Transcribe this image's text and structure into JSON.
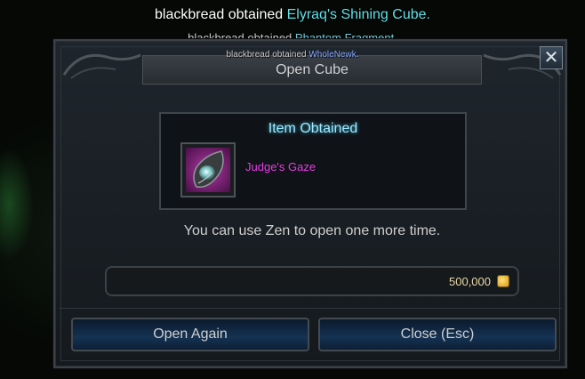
{
  "notifications": [
    {
      "player": "blackbread",
      "verb": "obtained",
      "item": "Elyraq's Shining Cube",
      "suffix": "."
    },
    {
      "player": "blackbread",
      "verb": "obtained",
      "item": "Phantom Fragment",
      "suffix": "."
    },
    {
      "player": "blackbread",
      "verb": "obtained",
      "item": "WholeNewk",
      "suffix": "."
    }
  ],
  "window": {
    "title": "Open Cube",
    "close_icon": "✕",
    "result_title": "Item Obtained",
    "item_name": "Judge's Gaze",
    "item_icon": "judges-gaze-icon",
    "info": "You can use Zen to open one more time.",
    "cost": "500,000",
    "currency_icon": "zen-coin-icon",
    "open_again_label": "Open Again",
    "close_label": "Close (Esc)"
  },
  "colors": {
    "item_rarity": "#e83ce6",
    "highlight": "#5ee0e8",
    "result_title": "#9fe9ff"
  }
}
